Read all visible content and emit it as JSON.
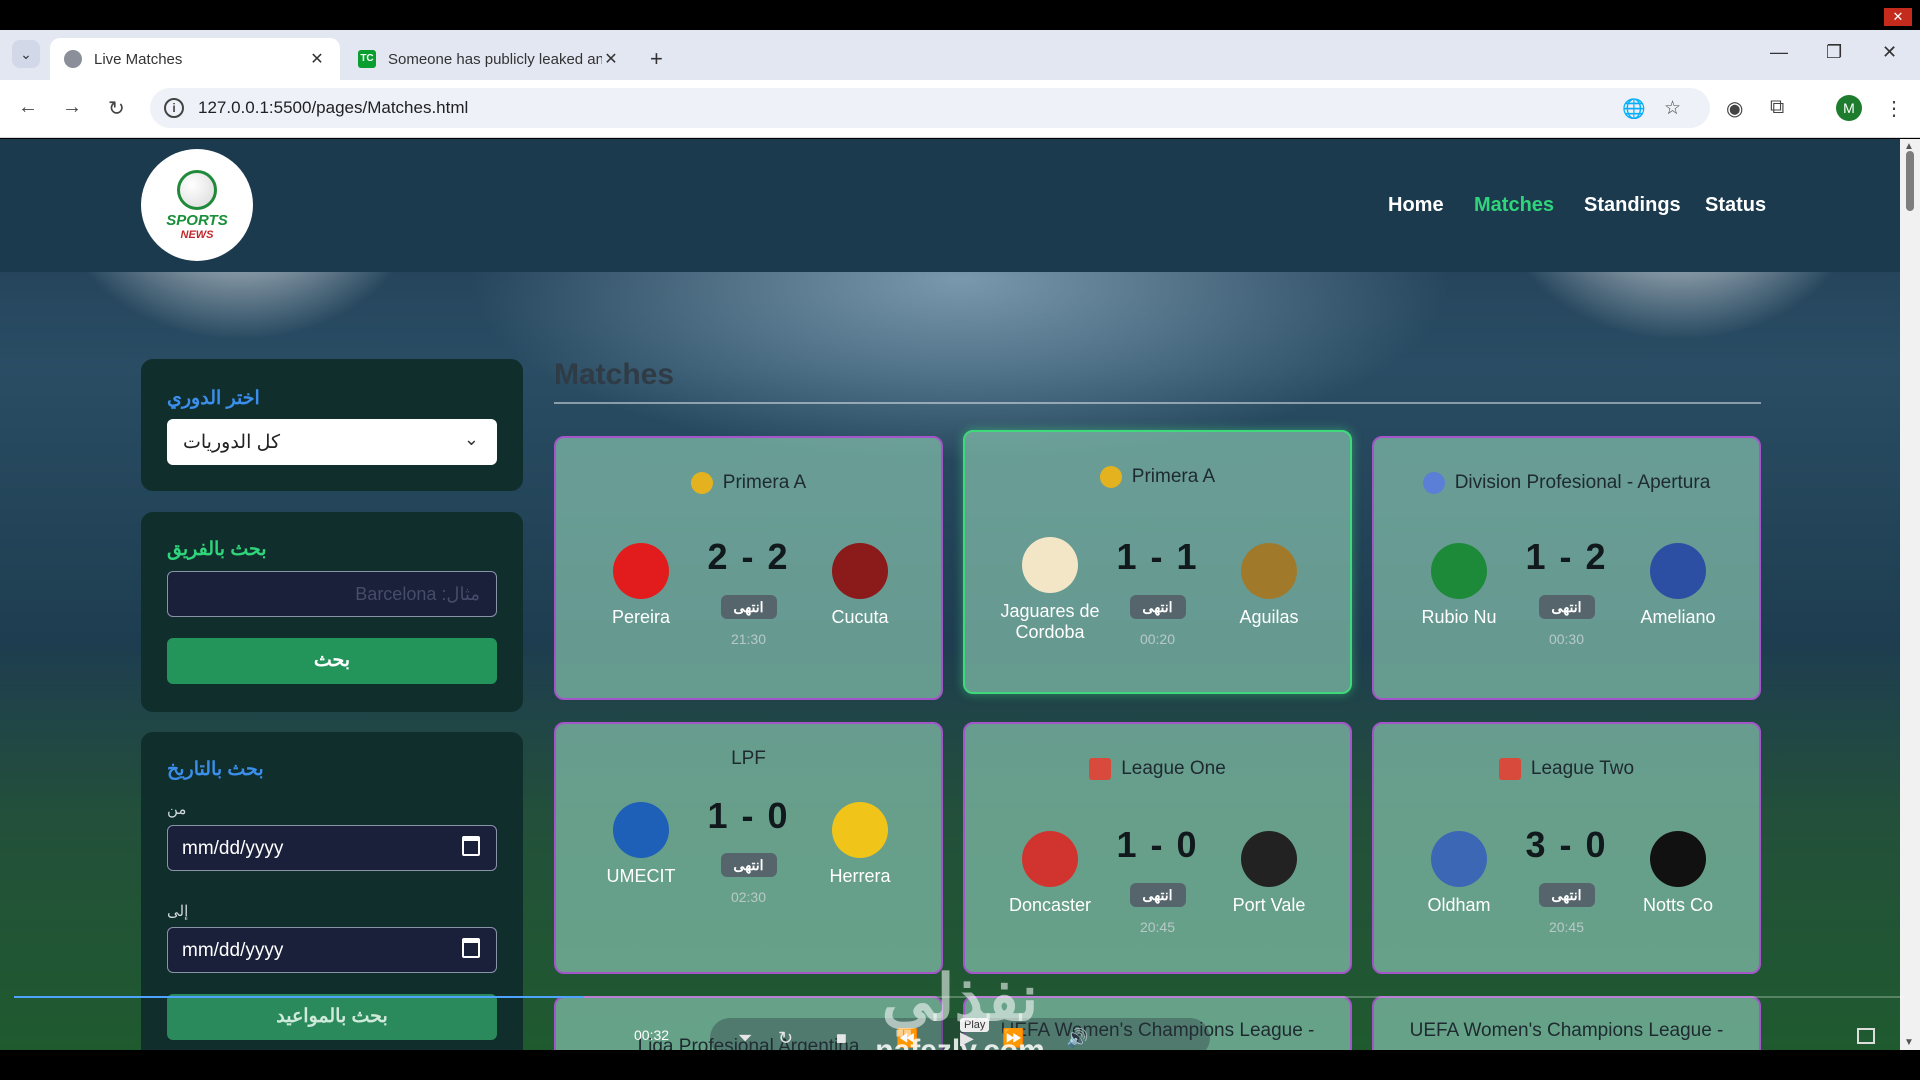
{
  "browser": {
    "close_glyph": "✕",
    "tab_menu": "⌄",
    "tabs": [
      {
        "title": "Live Matches",
        "close": "✕"
      },
      {
        "title": "Someone has publicly leaked an",
        "close": "✕",
        "icon": "TC"
      }
    ],
    "new_tab": "+",
    "window": {
      "minimize": "—",
      "restore": "❐",
      "close": "✕"
    },
    "nav": {
      "back": "←",
      "forward": "→",
      "reload": "↻"
    },
    "url": "127.0.0.1:5500/pages/Matches.html",
    "info_icon": "i",
    "icons": {
      "translate": "🌐",
      "bookmark": "☆",
      "extension": "⧉",
      "menu": "⋮",
      "shield": "◉"
    },
    "profile_initial": "M"
  },
  "site": {
    "logo": {
      "line1": "SPORTS",
      "line2": "NEWS"
    },
    "nav": [
      {
        "label": "Home",
        "active": false
      },
      {
        "label": "Matches",
        "active": true
      },
      {
        "label": "Standings",
        "active": false
      },
      {
        "label": "Status",
        "active": false
      }
    ]
  },
  "sidebar": {
    "league_filter": {
      "title": "اختر الدوري",
      "selected": "كل الدوريات",
      "chevron": "⌄"
    },
    "team_search": {
      "title": "بحث بالفريق",
      "placeholder": "مثال: Barcelona",
      "button": "بحث"
    },
    "date_search": {
      "title": "بحث بالتاريخ",
      "from_label": "من",
      "from_value": "mm/dd/yyyy",
      "to_label": "إلى",
      "to_value": "mm/dd/yyyy",
      "button": "بحث بالمواعيد"
    }
  },
  "matches": {
    "heading": "Matches",
    "status_label": "انتهى",
    "cards": [
      {
        "league": "Primera A",
        "home": "Pereira",
        "away": "Cucuta",
        "score": "2 - 2",
        "time": "21:30",
        "home_color": "#e21c1c",
        "away_color": "#8b1a1a",
        "league_color": "#e5b21f"
      },
      {
        "league": "Primera A",
        "home": "Jaguares de Cordoba",
        "away": "Aguilas",
        "score": "1 - 1",
        "time": "00:20",
        "home_color": "#f3e6c7",
        "away_color": "#a07a2a",
        "league_color": "#e5b21f"
      },
      {
        "league": "Division Profesional - Apertura",
        "home": "Rubio Nu",
        "away": "Ameliano",
        "score": "1 - 2",
        "time": "00:30",
        "home_color": "#1d8a3a",
        "away_color": "#2c4fa3",
        "league_color": "#5b7fd6"
      },
      {
        "league": "LPF",
        "home": "UMECIT",
        "away": "Herrera",
        "score": "1 - 0",
        "time": "02:30",
        "home_color": "#1e5fb8",
        "away_color": "#f0c419",
        "league_color": ""
      },
      {
        "league": "League One",
        "home": "Doncaster",
        "away": "Port Vale",
        "score": "1 - 0",
        "time": "20:45",
        "home_color": "#d1342f",
        "away_color": "#222222",
        "league_color": "#d84a3b"
      },
      {
        "league": "League Two",
        "home": "Oldham",
        "away": "Notts Co",
        "score": "3 - 0",
        "time": "20:45",
        "home_color": "#3c67b5",
        "away_color": "#111111",
        "league_color": "#d84a3b"
      },
      {
        "league": "Liga Profesional Argentina"
      },
      {
        "league": "UEFA Women's Champions League -"
      },
      {
        "league": "UEFA Women's Champions League -"
      }
    ]
  },
  "video": {
    "elapsed": "00:32",
    "tooltip": "Play",
    "controls": {
      "speed": "⏷",
      "loop": "↻",
      "stop": "■",
      "rewind": "⏪",
      "play": "▶",
      "forward": "⏩",
      "volume": "🔊"
    },
    "watermark": {
      "arabic": "نفذلي",
      "latin": "nafezly.com"
    }
  }
}
